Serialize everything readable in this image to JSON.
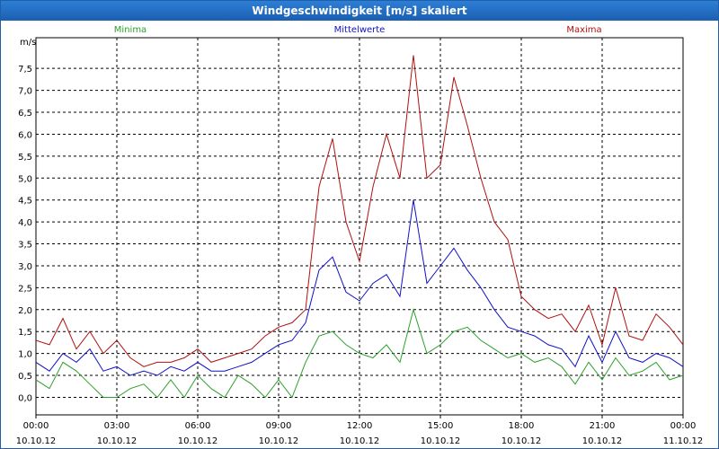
{
  "window": {
    "title": "Windgeschwindigkeit [m/s] skaliert"
  },
  "chart_data": {
    "type": "line",
    "title": "Windgeschwindigkeit [m/s] skaliert",
    "ylabel": "m/s",
    "xlabel": "",
    "ylim": [
      -0.4,
      8.2
    ],
    "y_ticks": [
      "0,0",
      "0,5",
      "1,0",
      "1,5",
      "2,0",
      "2,5",
      "3,0",
      "3,5",
      "4,0",
      "4,5",
      "5,0",
      "5,5",
      "6,0",
      "6,5",
      "7,0",
      "7,5"
    ],
    "y_tick_values": [
      0,
      0.5,
      1,
      1.5,
      2,
      2.5,
      3,
      3.5,
      4,
      4.5,
      5,
      5.5,
      6,
      6.5,
      7,
      7.5
    ],
    "x_ticks": [
      {
        "time": "00:00",
        "date": "10.10.12"
      },
      {
        "time": "03:00",
        "date": "10.10.12"
      },
      {
        "time": "06:00",
        "date": "10.10.12"
      },
      {
        "time": "09:00",
        "date": "10.10.12"
      },
      {
        "time": "12:00",
        "date": "10.10.12"
      },
      {
        "time": "15:00",
        "date": "10.10.12"
      },
      {
        "time": "18:00",
        "date": "10.10.12"
      },
      {
        "time": "21:00",
        "date": "10.10.12"
      },
      {
        "time": "00:00",
        "date": "11.10.12"
      }
    ],
    "x_range_hours": [
      0,
      24
    ],
    "grid": true,
    "legend": "top",
    "series": [
      {
        "name": "Minima",
        "color": "#2ca02c",
        "x": [
          0,
          0.5,
          1,
          1.5,
          2,
          2.5,
          3,
          3.5,
          4,
          4.5,
          5,
          5.5,
          6,
          6.5,
          7,
          7.5,
          8,
          8.5,
          9,
          9.5,
          10,
          10.5,
          11,
          11.5,
          12,
          12.5,
          13,
          13.5,
          14,
          14.5,
          15,
          15.5,
          16,
          16.5,
          17,
          17.5,
          18,
          18.5,
          19,
          19.5,
          20,
          20.5,
          21,
          21.5,
          22,
          22.5,
          23,
          23.5,
          24
        ],
        "values": [
          0.4,
          0.2,
          0.8,
          0.6,
          0.3,
          0.0,
          0.0,
          0.2,
          0.3,
          0.0,
          0.4,
          0.0,
          0.5,
          0.2,
          0.0,
          0.5,
          0.3,
          0.0,
          0.4,
          0.0,
          0.8,
          1.4,
          1.5,
          1.2,
          1.0,
          0.9,
          1.2,
          0.8,
          2.0,
          1.0,
          1.2,
          1.5,
          1.6,
          1.3,
          1.1,
          0.9,
          1.0,
          0.8,
          0.9,
          0.7,
          0.3,
          0.8,
          0.4,
          0.9,
          0.5,
          0.6,
          0.8,
          0.4,
          0.5
        ]
      },
      {
        "name": "Mittelwerte",
        "color": "#1010c8",
        "x": [
          0,
          0.5,
          1,
          1.5,
          2,
          2.5,
          3,
          3.5,
          4,
          4.5,
          5,
          5.5,
          6,
          6.5,
          7,
          7.5,
          8,
          8.5,
          9,
          9.5,
          10,
          10.5,
          11,
          11.5,
          12,
          12.5,
          13,
          13.5,
          14,
          14.5,
          15,
          15.5,
          16,
          16.5,
          17,
          17.5,
          18,
          18.5,
          19,
          19.5,
          20,
          20.5,
          21,
          21.5,
          22,
          22.5,
          23,
          23.5,
          24
        ],
        "values": [
          0.8,
          0.6,
          1.0,
          0.8,
          1.1,
          0.6,
          0.7,
          0.5,
          0.6,
          0.5,
          0.7,
          0.6,
          0.8,
          0.6,
          0.6,
          0.7,
          0.8,
          1.0,
          1.2,
          1.3,
          1.7,
          2.9,
          3.2,
          2.4,
          2.2,
          2.6,
          2.8,
          2.3,
          4.5,
          2.6,
          3.0,
          3.4,
          2.9,
          2.5,
          2.0,
          1.6,
          1.5,
          1.4,
          1.2,
          1.1,
          0.7,
          1.4,
          0.8,
          1.5,
          0.9,
          0.8,
          1.0,
          0.9,
          0.7
        ]
      },
      {
        "name": "Maxima",
        "color": "#b01010",
        "x": [
          0,
          0.5,
          1,
          1.5,
          2,
          2.5,
          3,
          3.5,
          4,
          4.5,
          5,
          5.5,
          6,
          6.5,
          7,
          7.5,
          8,
          8.5,
          9,
          9.5,
          10,
          10.5,
          11,
          11.5,
          12,
          12.5,
          13,
          13.5,
          14,
          14.5,
          15,
          15.5,
          16,
          16.5,
          17,
          17.5,
          18,
          18.5,
          19,
          19.5,
          20,
          20.5,
          21,
          21.5,
          22,
          22.5,
          23,
          23.5,
          24
        ],
        "values": [
          1.3,
          1.2,
          1.8,
          1.1,
          1.5,
          1.0,
          1.3,
          0.9,
          0.7,
          0.8,
          0.8,
          0.9,
          1.1,
          0.8,
          0.9,
          1.0,
          1.1,
          1.4,
          1.6,
          1.7,
          2.0,
          4.8,
          5.9,
          4.0,
          3.1,
          4.8,
          6.0,
          5.0,
          7.8,
          5.0,
          5.3,
          7.3,
          6.2,
          5.0,
          4.0,
          3.6,
          2.3,
          2.0,
          1.8,
          1.9,
          1.5,
          2.1,
          1.2,
          2.5,
          1.4,
          1.3,
          1.9,
          1.6,
          1.2
        ]
      }
    ]
  }
}
